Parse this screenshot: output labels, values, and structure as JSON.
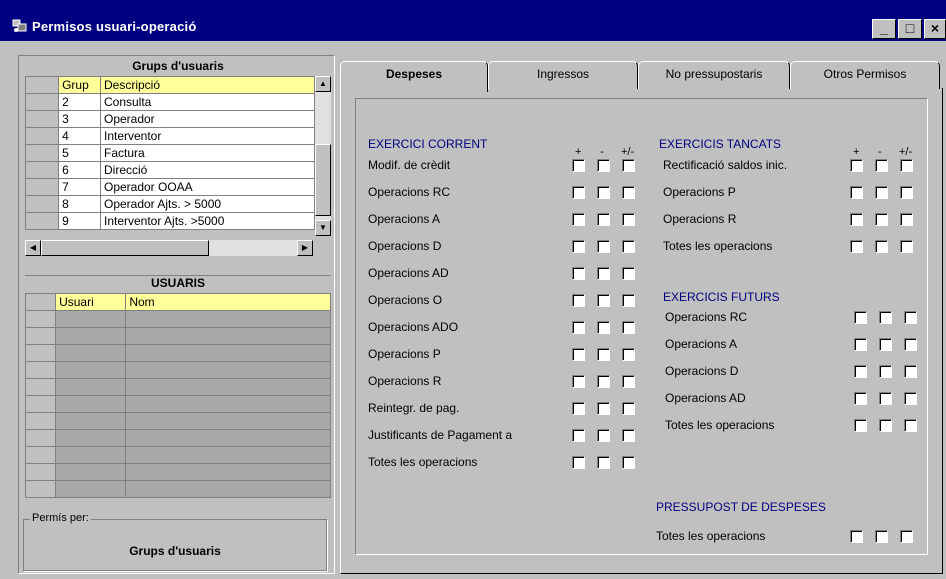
{
  "window": {
    "title": "Permisos usuari-operació",
    "buttons": {
      "minimize": "_",
      "maximize": "□",
      "close": "×"
    }
  },
  "groups": {
    "header": "Grups d'usuaris",
    "columns": [
      "Grup",
      "Descripció"
    ],
    "rows": [
      {
        "grup": "2",
        "desc": "Consulta"
      },
      {
        "grup": "3",
        "desc": "Operador"
      },
      {
        "grup": "4",
        "desc": "Interventor"
      },
      {
        "grup": "5",
        "desc": "Factura"
      },
      {
        "grup": "6",
        "desc": "Direcció"
      },
      {
        "grup": "7",
        "desc": "Operador OOAA"
      },
      {
        "grup": "8",
        "desc": "Operador Ajts. > 5000"
      },
      {
        "grup": "9",
        "desc": "Interventor Ajts. >5000"
      }
    ]
  },
  "users": {
    "header": "USUARIS",
    "columns": [
      "Usuari",
      "Nom"
    ]
  },
  "permis_per": {
    "legend": "Permís per:",
    "value": "Grups d'usuaris"
  },
  "tabs": [
    "Despeses",
    "Ingressos",
    "No pressupostaris",
    "Otros Permisos"
  ],
  "symbols": {
    "plus": "+",
    "minus": "-",
    "plusminus": "+/-"
  },
  "current": {
    "title": "EXERCICI CORRENT",
    "items": [
      "Modif. de crèdit",
      "Operacions RC",
      "Operacions A",
      "Operacions D",
      "Operacions AD",
      "Operacions O",
      "Operacions ADO",
      "Operacions P",
      "Operacions R",
      "Reintegr. de pag.",
      "Justificants de Pagament a",
      "Totes les operacions"
    ]
  },
  "closed": {
    "title": "EXERCICIS TANCATS",
    "items": [
      "Rectificació saldos inic.",
      "Operacions P",
      "Operacions R",
      "Totes les operacions"
    ]
  },
  "future": {
    "title": "EXERCICIS FUTURS",
    "items": [
      "Operacions RC",
      "Operacions A",
      "Operacions D",
      "Operacions AD",
      "Totes les operacions"
    ]
  },
  "budget": {
    "title": "PRESSUPOST DE DESPESES",
    "items": [
      "Totes les operacions"
    ]
  }
}
